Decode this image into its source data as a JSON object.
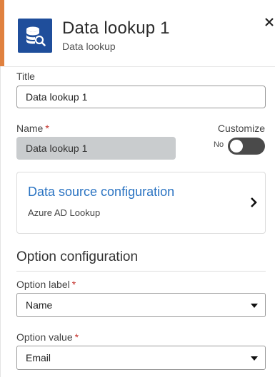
{
  "header": {
    "title": "Data lookup 1",
    "subtitle": "Data lookup",
    "icon": "database-search-icon",
    "accent_color": "#e0813f",
    "icon_bg": "#1f4e9b"
  },
  "fields": {
    "title_label": "Title",
    "title_value": "Data lookup 1",
    "name_label": "Name",
    "name_required": "*",
    "name_value": "Data lookup 1",
    "customize_label": "Customize",
    "customize_toggle_text": "No",
    "customize_on": false
  },
  "data_source": {
    "title": "Data source configuration",
    "subtitle": "Azure AD Lookup",
    "link_color": "#2a73c2"
  },
  "option_config": {
    "section_title": "Option configuration",
    "option_label": "Option label",
    "option_label_required": "*",
    "option_label_value": "Name",
    "option_value": "Option value",
    "option_value_required": "*",
    "option_value_value": "Email"
  }
}
